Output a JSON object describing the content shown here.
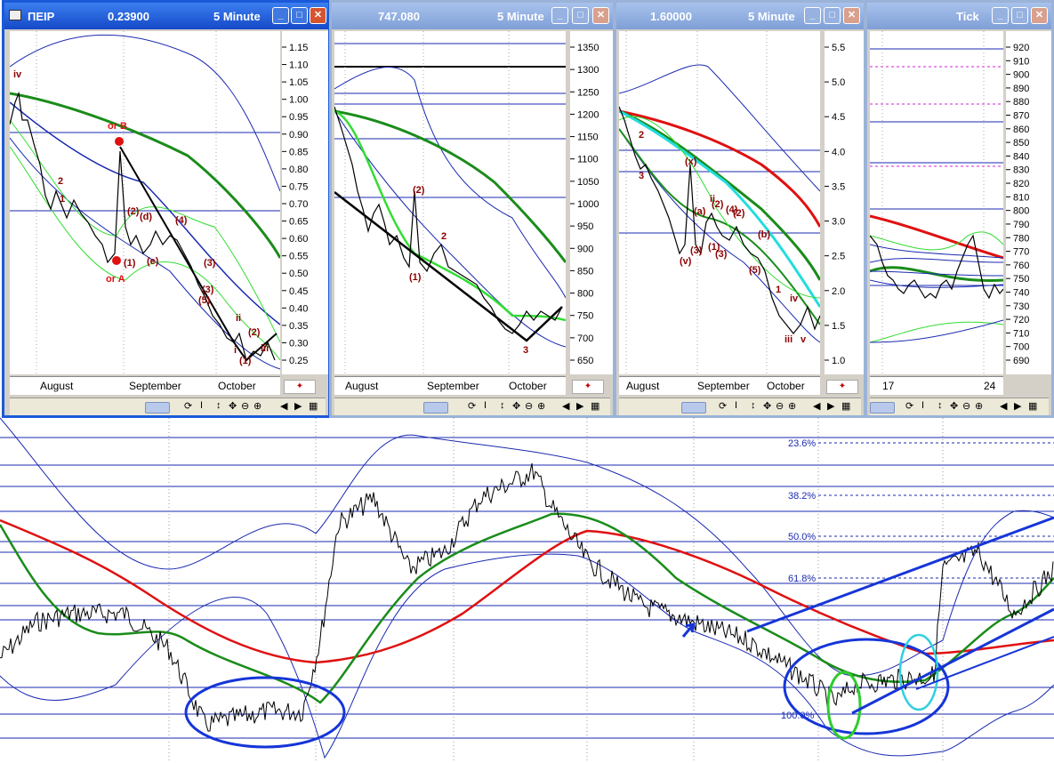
{
  "windows": [
    {
      "title": "ΠΕΙΡ",
      "value": "0.23900",
      "interval": "5 Minute",
      "price_ticks": [
        "1.15",
        "1.10",
        "1.05",
        "1.00",
        "0.95",
        "0.90",
        "0.85",
        "0.80",
        "0.75",
        "0.70",
        "0.65",
        "0.60",
        "0.55",
        "0.50",
        "0.45",
        "0.40",
        "0.35",
        "0.30",
        "0.25"
      ],
      "months": [
        "August",
        "September",
        "October"
      ],
      "labels": [
        "iv",
        "or B",
        "or A",
        "2",
        "1",
        "(1)",
        "(2)",
        "(d)",
        "(e)",
        "(4)",
        "(5)",
        "(3)",
        "ii",
        "(1)",
        "(2)",
        "(3)",
        "i",
        "iii"
      ]
    },
    {
      "title": "",
      "value": "747.080",
      "interval": "5 Minute",
      "price_ticks": [
        "1350",
        "1300",
        "1250",
        "1200",
        "1150",
        "1100",
        "1050",
        "1000",
        "950",
        "900",
        "850",
        "800",
        "750",
        "700",
        "650"
      ],
      "months": [
        "August",
        "September",
        "October"
      ],
      "labels": [
        "(2)",
        "(1)",
        "2",
        "3"
      ]
    },
    {
      "title": "",
      "value": "1.60000",
      "interval": "5 Minute",
      "price_ticks": [
        "5.5",
        "5.0",
        "4.5",
        "4.0",
        "3.5",
        "3.0",
        "2.5",
        "2.0",
        "1.5",
        "1.0"
      ],
      "months": [
        "August",
        "September",
        "October"
      ],
      "labels": [
        "2",
        "3",
        "(x)",
        "(a)",
        "(2)",
        "(3)",
        "(v)",
        "(1)",
        "(3)",
        "(2)",
        "(4)",
        "(5)",
        "ii",
        "(b)",
        "1",
        "iii",
        "iv",
        "v"
      ]
    },
    {
      "title": "Tick",
      "value": "",
      "interval": "",
      "price_ticks": [
        "920",
        "910",
        "900",
        "890",
        "880",
        "870",
        "860",
        "850",
        "840",
        "830",
        "820",
        "810",
        "800",
        "790",
        "780",
        "770",
        "760",
        "750",
        "740",
        "730",
        "720",
        "710",
        "700",
        "690"
      ],
      "months": [
        "17",
        "24"
      ],
      "labels": []
    }
  ],
  "toolbar_glyphs": {
    "scroll": "|||",
    "refresh": "⟳",
    "cursor": "I",
    "vmove": "↕",
    "move": "✥",
    "zoom_out": "⊖",
    "zoom_in": "⊕",
    "left": "◀",
    "right": "▶",
    "grid": "▦"
  },
  "icons": {
    "maximize": "maximize-icon",
    "minimize": "minimize-icon",
    "close": "close-icon"
  },
  "fib_levels": [
    "23.6%",
    "38.2%",
    "50.0%",
    "61.8%",
    "100.0%"
  ],
  "colors": {
    "price": "#000000",
    "ma_green": "#1a8c1a",
    "ma_red": "#e01010",
    "bands": "#1a2ab0",
    "light_green": "#33dd33",
    "cyan": "#22dddd",
    "trend_black": "#000000"
  },
  "chart_data": [
    {
      "type": "line",
      "title": "ΠΕΙΡ",
      "x": [
        "August",
        "September",
        "October"
      ],
      "ylim": [
        0.2,
        1.18
      ],
      "series": [
        {
          "values": [
            0.95,
            0.7,
            0.6,
            0.85,
            0.6,
            0.45,
            0.3,
            0.24
          ]
        }
      ]
    },
    {
      "type": "line",
      "title": "",
      "x": [
        "August",
        "September",
        "October"
      ],
      "ylim": [
        640,
        1390
      ],
      "series": [
        {
          "values": [
            1240,
            1000,
            920,
            1030,
            850,
            780,
            730,
            747
          ]
        }
      ]
    },
    {
      "type": "line",
      "title": "",
      "x": [
        "August",
        "September",
        "October"
      ],
      "ylim": [
        0.9,
        5.8
      ],
      "series": [
        {
          "values": [
            2.6,
            2.0,
            1.7,
            2.1,
            1.8,
            1.5,
            1.6
          ]
        }
      ]
    },
    {
      "type": "line",
      "title": "Tick",
      "x": [
        "17",
        "24"
      ],
      "ylim": [
        685,
        925
      ],
      "series": [
        {
          "values": [
            780,
            750,
            745,
            760,
            742,
            745,
            780,
            745
          ]
        }
      ]
    }
  ]
}
